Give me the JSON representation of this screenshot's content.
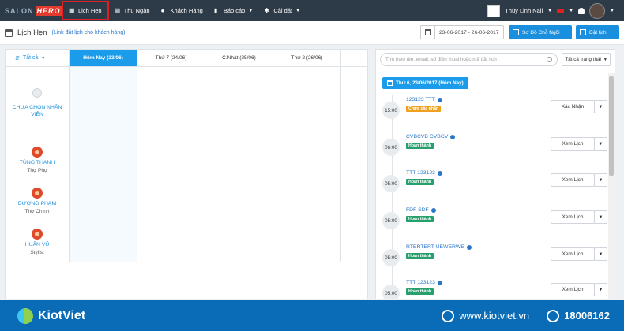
{
  "brand": {
    "part1": "SALON",
    "part2": "HERO"
  },
  "nav": [
    {
      "label": "Lịch Hẹn",
      "icon": "calendar-icon",
      "active": true
    },
    {
      "label": "Thu Ngân",
      "icon": "cashier-icon"
    },
    {
      "label": "Khách Hàng",
      "icon": "user-icon"
    },
    {
      "label": "Báo cáo",
      "icon": "chart-icon",
      "caret": true
    },
    {
      "label": "Cài đặt",
      "icon": "gear-icon",
      "caret": true
    }
  ],
  "user": {
    "name": "Thùy Linh Nail"
  },
  "page": {
    "title": "Lịch Hẹn",
    "link": "(Link đặt lịch cho khách hàng)"
  },
  "toolbar": {
    "date_range": "23-06-2017 - 26-06-2017",
    "seat_map": "Sơ Đồ Chỗ Ngồi",
    "book": "Đặt lịch"
  },
  "calendar": {
    "staff_filter": "Tất cả",
    "days": [
      "Hôm Nay (23/06)",
      "Thứ 7 (24/06)",
      "C.Nhật (25/06)",
      "Thứ 2 (26/06)"
    ],
    "staff": [
      {
        "name": "CHƯA CHỌN NHÂN VIÊN",
        "role": ""
      },
      {
        "name": "TÙNG THANH",
        "role": "Thợ Phụ"
      },
      {
        "name": "DƯƠNG PHẠM",
        "role": "Thợ Chính"
      },
      {
        "name": "HUÂN VŨ",
        "role": "Stylist"
      }
    ]
  },
  "panel": {
    "search_placeholder": "Tìm theo tên, email, số điện thoại hoặc mã đặt lịch",
    "status_filter": "Tất cả trạng thái",
    "date_label": "Thứ 6, 23/06/2017 (Hôm Nay)",
    "appointments": [
      {
        "time": "15:00",
        "name": "123123 TTT",
        "status": "Chưa xác nhận",
        "status_color": "#f0a020",
        "action": "Xác Nhận"
      },
      {
        "time": "06:00",
        "name": "CVBCVB CVBCV",
        "status": "Hoàn thành",
        "status_color": "#28a06e",
        "action": "Xem Lịch"
      },
      {
        "time": "05:00",
        "name": "TTT 123123",
        "status": "Hoàn thành",
        "status_color": "#28a06e",
        "action": "Xem Lịch"
      },
      {
        "time": "05:00",
        "name": "FDF SDF",
        "status": "Hoàn thành",
        "status_color": "#28a06e",
        "action": "Xem Lịch"
      },
      {
        "time": "05:00",
        "name": "RTERTERT UEWERWE",
        "status": "Hoàn thành",
        "status_color": "#28a06e",
        "action": "Xem Lịch"
      },
      {
        "time": "05:00",
        "name": "TTT 123123",
        "status": "Hoàn thành",
        "status_color": "#28a06e",
        "action": "Xem Lịch"
      }
    ]
  },
  "footer": {
    "brand": "KiotViet",
    "website": "www.kiotviet.vn",
    "hotline": "18006162"
  }
}
